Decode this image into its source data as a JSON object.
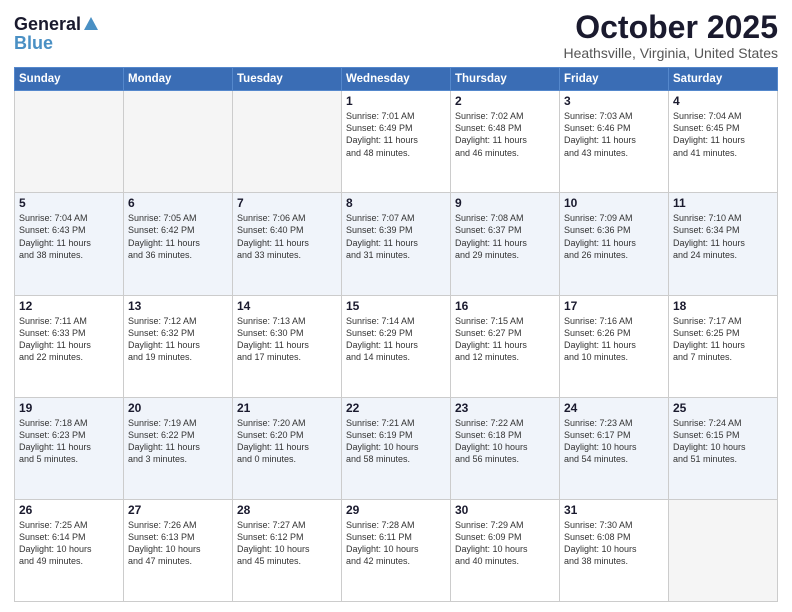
{
  "logo": {
    "general": "General",
    "blue": "Blue"
  },
  "header": {
    "month": "October 2025",
    "location": "Heathsville, Virginia, United States"
  },
  "weekdays": [
    "Sunday",
    "Monday",
    "Tuesday",
    "Wednesday",
    "Thursday",
    "Friday",
    "Saturday"
  ],
  "weeks": [
    [
      {
        "num": "",
        "info": "",
        "empty": true
      },
      {
        "num": "",
        "info": "",
        "empty": true
      },
      {
        "num": "",
        "info": "",
        "empty": true
      },
      {
        "num": "1",
        "info": "Sunrise: 7:01 AM\nSunset: 6:49 PM\nDaylight: 11 hours\nand 48 minutes."
      },
      {
        "num": "2",
        "info": "Sunrise: 7:02 AM\nSunset: 6:48 PM\nDaylight: 11 hours\nand 46 minutes."
      },
      {
        "num": "3",
        "info": "Sunrise: 7:03 AM\nSunset: 6:46 PM\nDaylight: 11 hours\nand 43 minutes."
      },
      {
        "num": "4",
        "info": "Sunrise: 7:04 AM\nSunset: 6:45 PM\nDaylight: 11 hours\nand 41 minutes."
      }
    ],
    [
      {
        "num": "5",
        "info": "Sunrise: 7:04 AM\nSunset: 6:43 PM\nDaylight: 11 hours\nand 38 minutes."
      },
      {
        "num": "6",
        "info": "Sunrise: 7:05 AM\nSunset: 6:42 PM\nDaylight: 11 hours\nand 36 minutes."
      },
      {
        "num": "7",
        "info": "Sunrise: 7:06 AM\nSunset: 6:40 PM\nDaylight: 11 hours\nand 33 minutes."
      },
      {
        "num": "8",
        "info": "Sunrise: 7:07 AM\nSunset: 6:39 PM\nDaylight: 11 hours\nand 31 minutes."
      },
      {
        "num": "9",
        "info": "Sunrise: 7:08 AM\nSunset: 6:37 PM\nDaylight: 11 hours\nand 29 minutes."
      },
      {
        "num": "10",
        "info": "Sunrise: 7:09 AM\nSunset: 6:36 PM\nDaylight: 11 hours\nand 26 minutes."
      },
      {
        "num": "11",
        "info": "Sunrise: 7:10 AM\nSunset: 6:34 PM\nDaylight: 11 hours\nand 24 minutes."
      }
    ],
    [
      {
        "num": "12",
        "info": "Sunrise: 7:11 AM\nSunset: 6:33 PM\nDaylight: 11 hours\nand 22 minutes."
      },
      {
        "num": "13",
        "info": "Sunrise: 7:12 AM\nSunset: 6:32 PM\nDaylight: 11 hours\nand 19 minutes."
      },
      {
        "num": "14",
        "info": "Sunrise: 7:13 AM\nSunset: 6:30 PM\nDaylight: 11 hours\nand 17 minutes."
      },
      {
        "num": "15",
        "info": "Sunrise: 7:14 AM\nSunset: 6:29 PM\nDaylight: 11 hours\nand 14 minutes."
      },
      {
        "num": "16",
        "info": "Sunrise: 7:15 AM\nSunset: 6:27 PM\nDaylight: 11 hours\nand 12 minutes."
      },
      {
        "num": "17",
        "info": "Sunrise: 7:16 AM\nSunset: 6:26 PM\nDaylight: 11 hours\nand 10 minutes."
      },
      {
        "num": "18",
        "info": "Sunrise: 7:17 AM\nSunset: 6:25 PM\nDaylight: 11 hours\nand 7 minutes."
      }
    ],
    [
      {
        "num": "19",
        "info": "Sunrise: 7:18 AM\nSunset: 6:23 PM\nDaylight: 11 hours\nand 5 minutes."
      },
      {
        "num": "20",
        "info": "Sunrise: 7:19 AM\nSunset: 6:22 PM\nDaylight: 11 hours\nand 3 minutes."
      },
      {
        "num": "21",
        "info": "Sunrise: 7:20 AM\nSunset: 6:20 PM\nDaylight: 11 hours\nand 0 minutes."
      },
      {
        "num": "22",
        "info": "Sunrise: 7:21 AM\nSunset: 6:19 PM\nDaylight: 10 hours\nand 58 minutes."
      },
      {
        "num": "23",
        "info": "Sunrise: 7:22 AM\nSunset: 6:18 PM\nDaylight: 10 hours\nand 56 minutes."
      },
      {
        "num": "24",
        "info": "Sunrise: 7:23 AM\nSunset: 6:17 PM\nDaylight: 10 hours\nand 54 minutes."
      },
      {
        "num": "25",
        "info": "Sunrise: 7:24 AM\nSunset: 6:15 PM\nDaylight: 10 hours\nand 51 minutes."
      }
    ],
    [
      {
        "num": "26",
        "info": "Sunrise: 7:25 AM\nSunset: 6:14 PM\nDaylight: 10 hours\nand 49 minutes."
      },
      {
        "num": "27",
        "info": "Sunrise: 7:26 AM\nSunset: 6:13 PM\nDaylight: 10 hours\nand 47 minutes."
      },
      {
        "num": "28",
        "info": "Sunrise: 7:27 AM\nSunset: 6:12 PM\nDaylight: 10 hours\nand 45 minutes."
      },
      {
        "num": "29",
        "info": "Sunrise: 7:28 AM\nSunset: 6:11 PM\nDaylight: 10 hours\nand 42 minutes."
      },
      {
        "num": "30",
        "info": "Sunrise: 7:29 AM\nSunset: 6:09 PM\nDaylight: 10 hours\nand 40 minutes."
      },
      {
        "num": "31",
        "info": "Sunrise: 7:30 AM\nSunset: 6:08 PM\nDaylight: 10 hours\nand 38 minutes."
      },
      {
        "num": "",
        "info": "",
        "empty": true
      }
    ]
  ]
}
